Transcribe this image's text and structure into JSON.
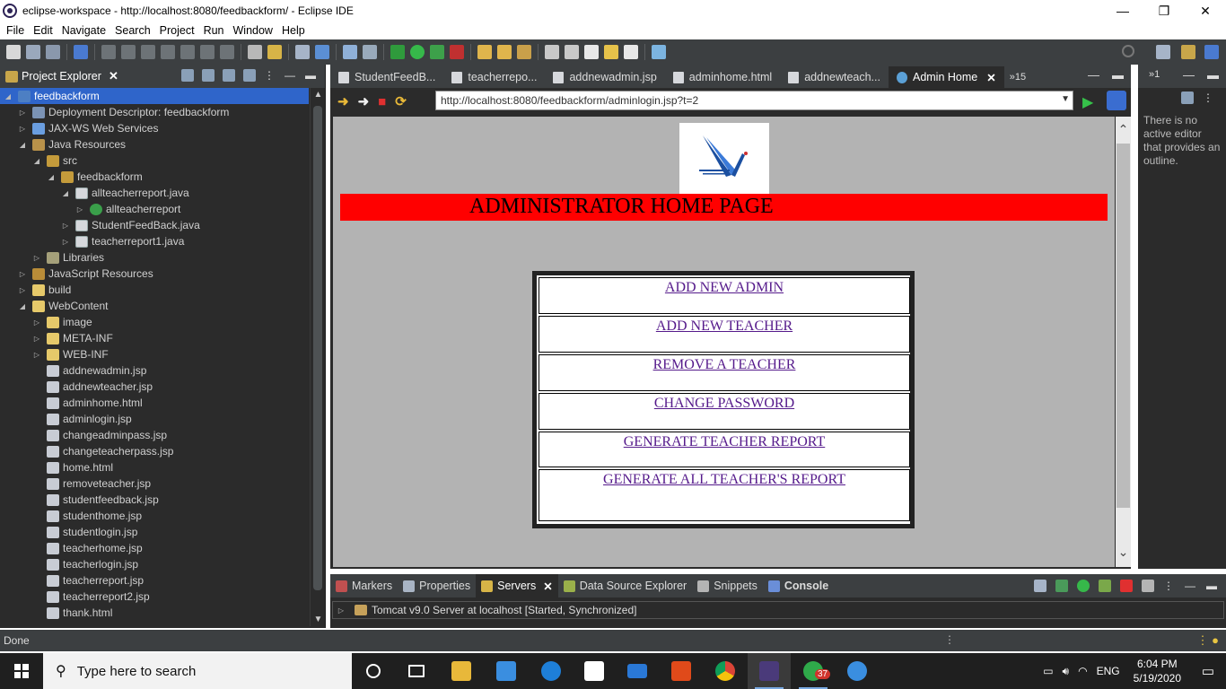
{
  "window": {
    "title": "eclipse-workspace - http://localhost:8080/feedbackform/ - Eclipse IDE",
    "controls": [
      "—",
      "❐",
      "✕"
    ]
  },
  "menubar": [
    "File",
    "Edit",
    "Navigate",
    "Search",
    "Project",
    "Run",
    "Window",
    "Help"
  ],
  "project_explorer": {
    "title": "Project Explorer",
    "tree": [
      {
        "label": "feedbackform",
        "level": 0,
        "twisty": "expanded",
        "icon": "project-icon",
        "selected": true
      },
      {
        "label": "Deployment Descriptor: feedbackform",
        "level": 1,
        "twisty": "collapsed",
        "icon": "deployment-descriptor-icon"
      },
      {
        "label": "JAX-WS Web Services",
        "level": 1,
        "twisty": "collapsed",
        "icon": "web-services-icon"
      },
      {
        "label": "Java Resources",
        "level": 1,
        "twisty": "expanded",
        "icon": "java-resources-icon"
      },
      {
        "label": "src",
        "level": 2,
        "twisty": "expanded",
        "icon": "source-folder-icon"
      },
      {
        "label": "feedbackform",
        "level": 3,
        "twisty": "expanded",
        "icon": "package-icon"
      },
      {
        "label": "allteacherreport.java",
        "level": 4,
        "twisty": "expanded",
        "icon": "java-file-icon"
      },
      {
        "label": "allteacherreport",
        "level": 5,
        "twisty": "collapsed",
        "icon": "class-icon"
      },
      {
        "label": "StudentFeedBack.java",
        "level": 4,
        "twisty": "collapsed",
        "icon": "java-file-icon"
      },
      {
        "label": "teacherreport1.java",
        "level": 4,
        "twisty": "collapsed",
        "icon": "java-file-icon"
      },
      {
        "label": "Libraries",
        "level": 2,
        "twisty": "collapsed",
        "icon": "libraries-icon"
      },
      {
        "label": "JavaScript Resources",
        "level": 1,
        "twisty": "collapsed",
        "icon": "javascript-resources-icon"
      },
      {
        "label": "build",
        "level": 1,
        "twisty": "collapsed",
        "icon": "folder-icon"
      },
      {
        "label": "WebContent",
        "level": 1,
        "twisty": "expanded",
        "icon": "folder-icon"
      },
      {
        "label": "image",
        "level": 2,
        "twisty": "collapsed",
        "icon": "folder-icon"
      },
      {
        "label": "META-INF",
        "level": 2,
        "twisty": "collapsed",
        "icon": "folder-icon"
      },
      {
        "label": "WEB-INF",
        "level": 2,
        "twisty": "collapsed",
        "icon": "folder-icon"
      },
      {
        "label": "addnewadmin.jsp",
        "level": 2,
        "twisty": "none",
        "icon": "file-icon"
      },
      {
        "label": "addnewteacher.jsp",
        "level": 2,
        "twisty": "none",
        "icon": "file-icon"
      },
      {
        "label": "adminhome.html",
        "level": 2,
        "twisty": "none",
        "icon": "file-icon"
      },
      {
        "label": "adminlogin.jsp",
        "level": 2,
        "twisty": "none",
        "icon": "file-icon"
      },
      {
        "label": "changeadminpass.jsp",
        "level": 2,
        "twisty": "none",
        "icon": "file-icon"
      },
      {
        "label": "changeteacherpass.jsp",
        "level": 2,
        "twisty": "none",
        "icon": "file-icon"
      },
      {
        "label": "home.html",
        "level": 2,
        "twisty": "none",
        "icon": "file-icon"
      },
      {
        "label": "removeteacher.jsp",
        "level": 2,
        "twisty": "none",
        "icon": "file-icon"
      },
      {
        "label": "studentfeedback.jsp",
        "level": 2,
        "twisty": "none",
        "icon": "file-icon"
      },
      {
        "label": "studenthome.jsp",
        "level": 2,
        "twisty": "none",
        "icon": "file-icon"
      },
      {
        "label": "studentlogin.jsp",
        "level": 2,
        "twisty": "none",
        "icon": "file-icon"
      },
      {
        "label": "teacherhome.jsp",
        "level": 2,
        "twisty": "none",
        "icon": "file-icon"
      },
      {
        "label": "teacherlogin.jsp",
        "level": 2,
        "twisty": "none",
        "icon": "file-icon"
      },
      {
        "label": "teacherreport.jsp",
        "level": 2,
        "twisty": "none",
        "icon": "file-icon"
      },
      {
        "label": "teacherreport2.jsp",
        "level": 2,
        "twisty": "none",
        "icon": "file-icon"
      },
      {
        "label": "thank.html",
        "level": 2,
        "twisty": "none",
        "icon": "file-icon"
      }
    ]
  },
  "editor": {
    "tabs": [
      {
        "label": "StudentFeedB...",
        "active": false
      },
      {
        "label": "teacherrepo...",
        "active": false
      },
      {
        "label": "addnewadmin.jsp",
        "active": false
      },
      {
        "label": "adminhome.html",
        "active": false
      },
      {
        "label": "addnewteach...",
        "active": false
      },
      {
        "label": "Admin Home",
        "active": true
      }
    ],
    "overflow_label": "»15",
    "url": "http://localhost:8080/feedbackform/adminlogin.jsp?t=2"
  },
  "web_page": {
    "banner_title": "ADMINISTRATOR HOME PAGE",
    "links": [
      "ADD NEW ADMIN",
      "ADD NEW TEACHER",
      "REMOVE A TEACHER",
      "CHANGE PASSWORD",
      "GENERATE TEACHER REPORT",
      "GENERATE ALL TEACHER'S REPORT"
    ],
    "colors": {
      "banner": "#ff0000",
      "page_background": "#b3b3b3",
      "link": "#551a8b"
    }
  },
  "outline": {
    "overflow_label": "»1",
    "message": "There is no active editor that provides an outline."
  },
  "bottom_panel": {
    "tabs": [
      {
        "label": "Markers",
        "active": false
      },
      {
        "label": "Properties",
        "active": false
      },
      {
        "label": "Servers",
        "active": true
      },
      {
        "label": "Data Source Explorer",
        "active": false
      },
      {
        "label": "Snippets",
        "active": false
      },
      {
        "label": "Console",
        "active": false,
        "bold": true
      }
    ],
    "server": "Tomcat v9.0 Server at localhost  [Started, Synchronized]"
  },
  "status": "Done",
  "taskbar": {
    "search_placeholder": "Type here to search",
    "language": "ENG",
    "time": "6:04 PM",
    "date": "5/19/2020",
    "badge": "37"
  }
}
